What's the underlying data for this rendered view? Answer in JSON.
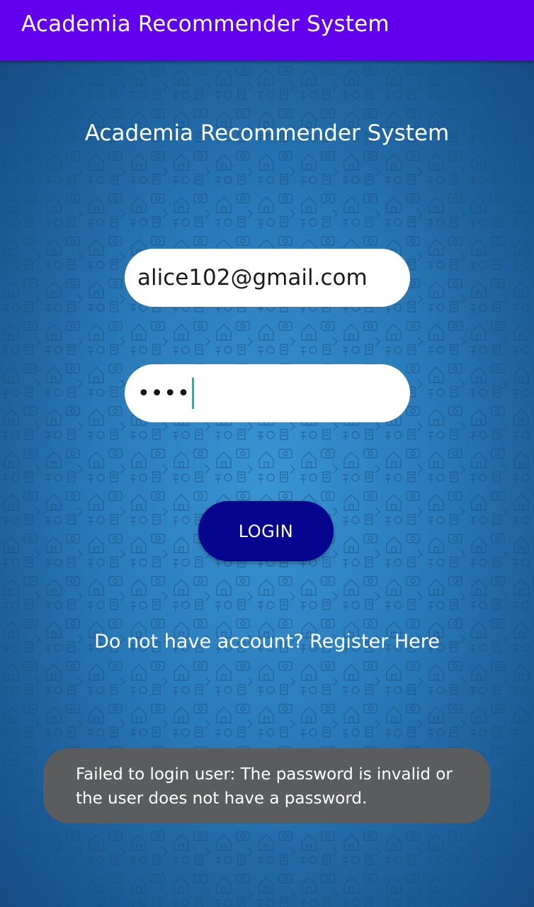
{
  "app_bar": {
    "title": "Academia Recommender System"
  },
  "login_form": {
    "heading": "Academia Recommender System",
    "email": {
      "value": "alice102@gmail.com"
    },
    "password": {
      "masked_value": "••••"
    },
    "login_button_label": "LOGIN",
    "register_link": "Do not have account? Register Here"
  },
  "toast": {
    "message": "Failed to login user: The password is invalid or the user does not have a password."
  },
  "colors": {
    "app_bar": "#6200ee",
    "background": "#2f7fbd",
    "login_button": "#05058f",
    "toast": "#5a5c5e",
    "caret": "#1bb5a7"
  }
}
